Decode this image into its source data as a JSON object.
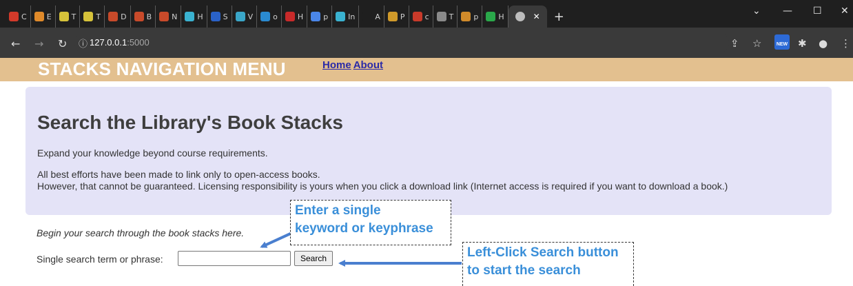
{
  "browser": {
    "tabs": [
      {
        "label": "C",
        "color": "#d23a2a"
      },
      {
        "label": "E",
        "color": "#e08a2a"
      },
      {
        "label": "T",
        "color": "#d6c23a"
      },
      {
        "label": "T",
        "color": "#d6c23a"
      },
      {
        "label": "D",
        "color": "#c84a2a"
      },
      {
        "label": "B",
        "color": "#c84a2a"
      },
      {
        "label": "N",
        "color": "#c84a2a"
      },
      {
        "label": "H",
        "color": "#3ab2d0"
      },
      {
        "label": "S",
        "color": "#2a62c8"
      },
      {
        "label": "V",
        "color": "#3aa6c8"
      },
      {
        "label": "o",
        "color": "#2a8ad0"
      },
      {
        "label": "H",
        "color": "#c82a2a"
      },
      {
        "label": "p",
        "color": "#4a86e8"
      },
      {
        "label": "In",
        "color": "#3ab2d0"
      },
      {
        "label": "A",
        "color": "#1f1f1f"
      },
      {
        "label": "P",
        "color": "#d09a2a"
      },
      {
        "label": "c",
        "color": "#c83a2a"
      },
      {
        "label": "T",
        "color": "#8a8a8a"
      },
      {
        "label": "p",
        "color": "#d08a2a"
      },
      {
        "label": "H",
        "color": "#2aa84a"
      }
    ],
    "active_tab_close": "✕",
    "new_tab": "+",
    "address": {
      "host": "127.0.0.1",
      "port": ":5000"
    }
  },
  "page": {
    "nav_title": "STACKS NAVIGATION MENU",
    "nav_links": [
      "Home",
      "About"
    ],
    "heading": "Search the Library's Book Stacks",
    "intro": "Expand your knowledge beyond course requirements.",
    "notice_line1": "All best efforts have been made to link only to open-access books.",
    "notice_line2": "However, that cannot be guaranteed. Licensing responsibility is yours when you click a download link (Internet access is required if you want to download a book.)",
    "begin": "Begin your search through the book stacks here.",
    "search_label": "Single search term or phrase:",
    "search_value": "",
    "search_button": "Search"
  },
  "annotations": {
    "callout1_line1": "Enter a single",
    "callout1_line2": "keyword or keyphrase",
    "callout2_line1": "Left-Click Search button",
    "callout2_line2": "to start the search",
    "color": "#3a8fd9",
    "arrow_color": "#4a7fcf"
  }
}
